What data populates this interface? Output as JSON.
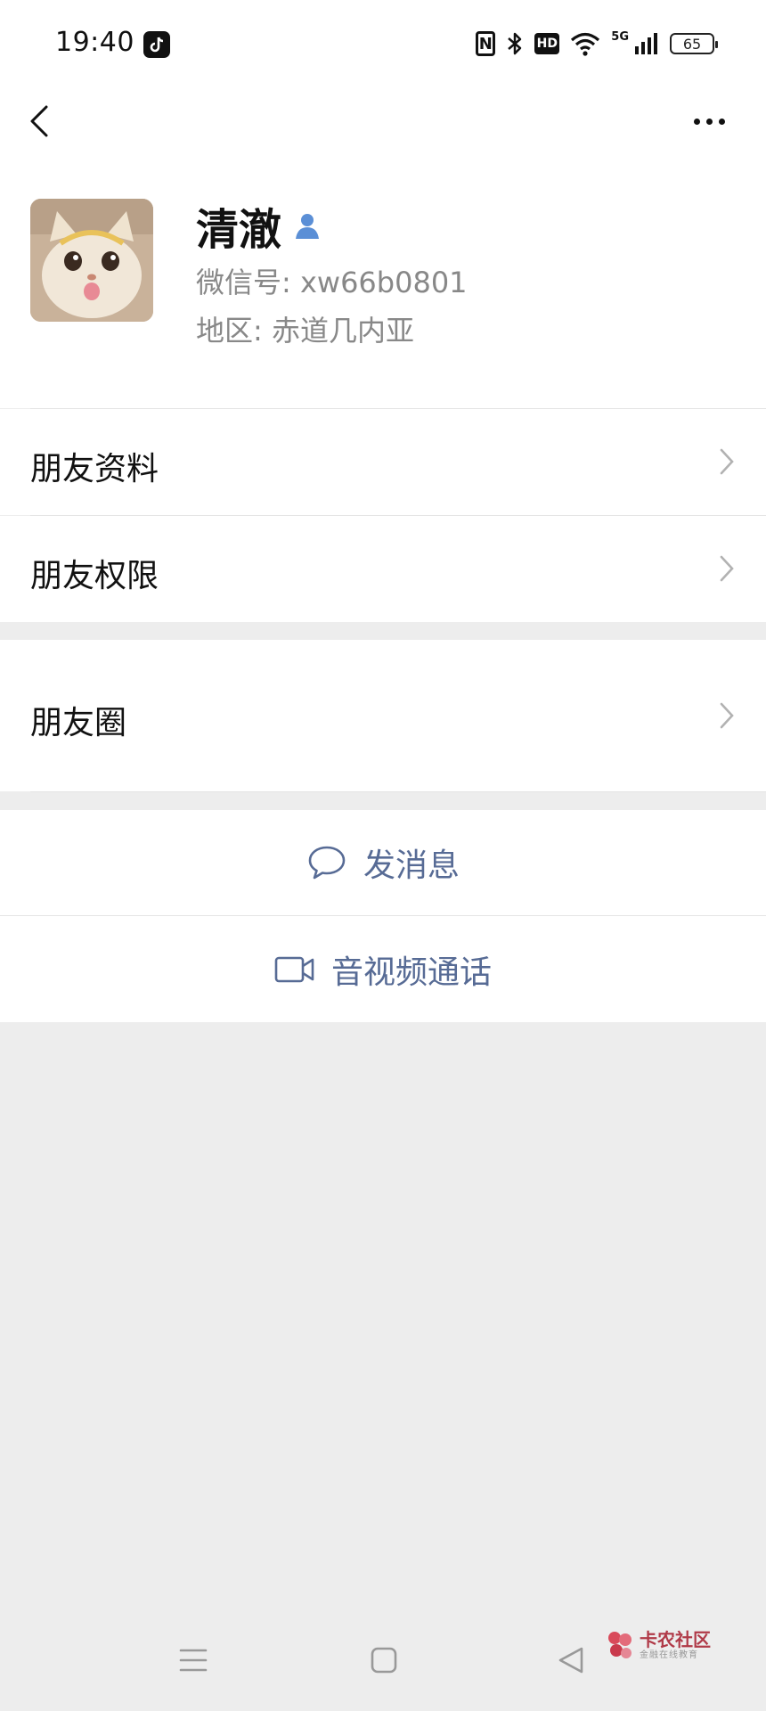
{
  "status_bar": {
    "time": "19:40",
    "network": "5G",
    "hd_label": "HD",
    "nfc_label": "N",
    "battery": "65",
    "app_icon": "tiktok-icon"
  },
  "nav": {
    "back_icon": "chevron-left-icon",
    "more_icon": "more-dots-icon"
  },
  "profile": {
    "name": "清澈",
    "wechat_id": "微信号: xw66b0801",
    "region": "地区: 赤道几内亚",
    "badge_icon": "contact-person-icon"
  },
  "menu": {
    "friend_info": "朋友资料",
    "friend_permissions": "朋友权限",
    "moments": "朋友圈"
  },
  "actions": {
    "send_message": "发消息",
    "av_call": "音视频通话"
  },
  "watermark": {
    "title": "卡农社区",
    "subtitle": "金融在线教育"
  },
  "colors": {
    "link_blue": "#576b95",
    "background": "#ededed",
    "badge_blue": "#5b8fd6"
  }
}
